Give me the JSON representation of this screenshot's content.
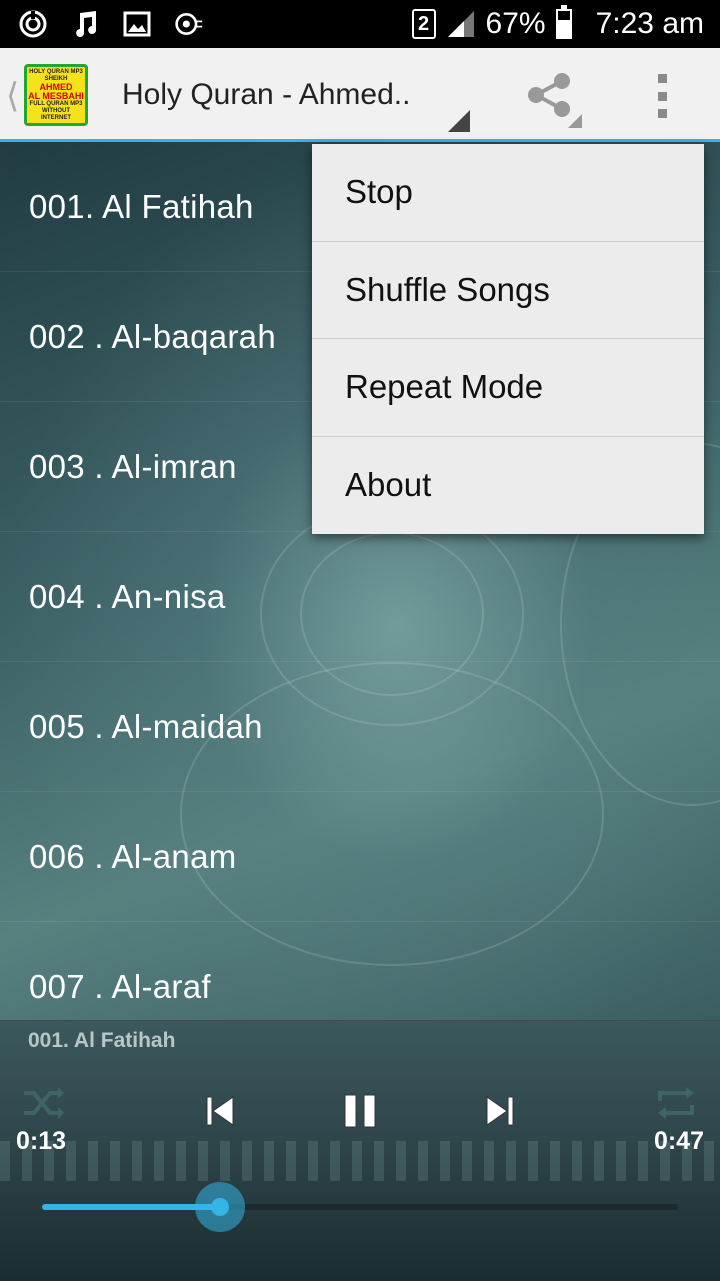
{
  "status_bar": {
    "sim_slot": "2",
    "battery_percent": "67%",
    "battery_level": 0.67,
    "time": "7:23 am",
    "notification_icons": [
      "cast-icon",
      "music-note-icon",
      "image-icon",
      "media-record-icon"
    ]
  },
  "action_bar": {
    "title": "Holy Quran - Ahmed..",
    "app_icon_text": [
      "HOLY QURAN MP3",
      "SHEIKH",
      "AHMED",
      "AL MESBAHI",
      "FULL QURAN MP3",
      "WITHOUT INTERNET"
    ],
    "accent_color": "#33b5e5"
  },
  "tracks": [
    "001. Al Fatihah",
    "002 . Al-baqarah",
    "003 . Al-imran",
    "004 . An-nisa",
    "005 . Al-maidah",
    "006 . Al-anam",
    "007 . Al-araf"
  ],
  "menu": {
    "items": [
      "Stop",
      "Shuffle Songs",
      "Repeat Mode",
      "About"
    ]
  },
  "player": {
    "now_playing": "001. Al Fatihah",
    "elapsed": "0:13",
    "duration": "0:47",
    "progress": 0.28
  }
}
